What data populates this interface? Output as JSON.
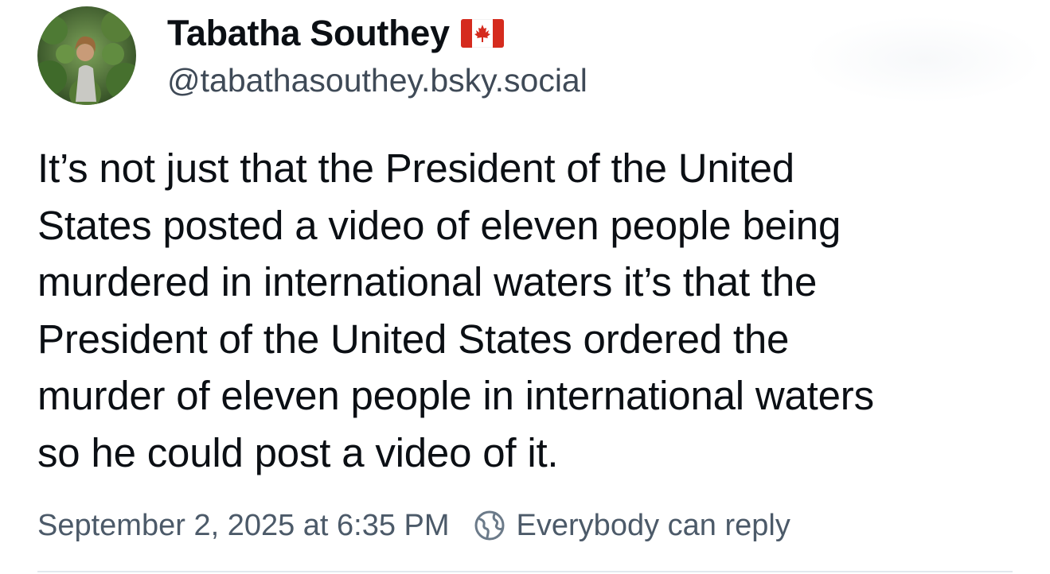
{
  "author": {
    "display_name": "Tabatha Southey",
    "handle": "@tabathasouthey.bsky.social",
    "flag_icon": "canada-flag-icon",
    "avatar_icon": "avatar-photo-icon"
  },
  "post": {
    "text": "It’s not just that the President of the United\nStates posted a video of eleven people being\nmurdered in international waters it’s that the\nPresident of the United States ordered the\nmurder of eleven people in international waters\nso he could post a video of it."
  },
  "meta": {
    "timestamp": "September 2, 2025 at 6:35 PM",
    "reply_setting": "Everybody can reply",
    "reply_icon": "globe-icon"
  },
  "colors": {
    "text": "#0b0f14",
    "secondary": "#4c5a69",
    "handle": "#3f4a57",
    "divider": "#e3e8ee",
    "flag_red": "#d52b1e"
  }
}
